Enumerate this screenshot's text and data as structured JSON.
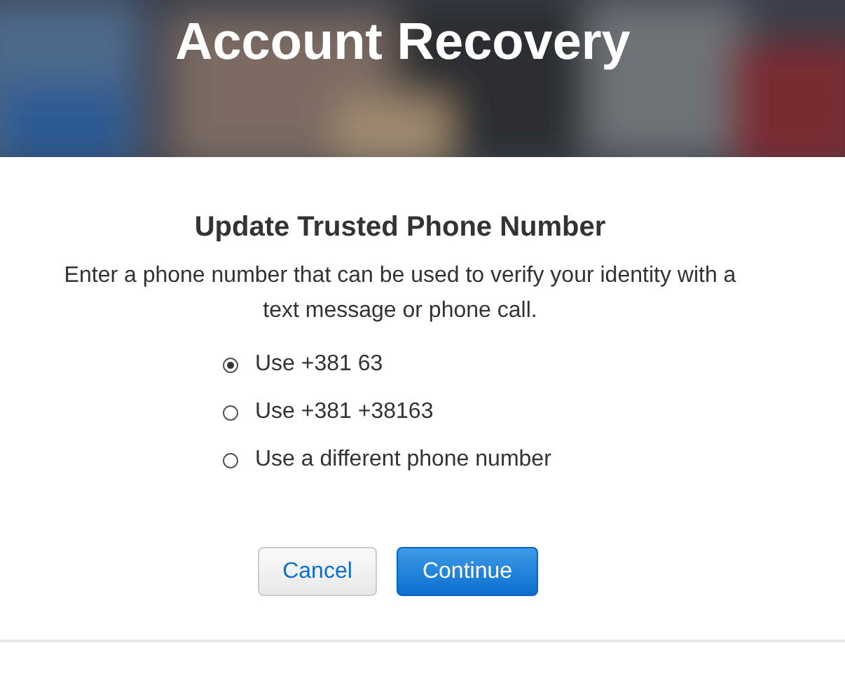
{
  "header": {
    "title": "Account Recovery"
  },
  "heading": "Update Trusted Phone Number",
  "description": "Enter a phone number that can be used to verify your identity with a text message or phone call.",
  "options": [
    {
      "label": "Use +381 63",
      "selected": true
    },
    {
      "label": "Use +381 +38163",
      "selected": false
    },
    {
      "label": "Use a different phone number",
      "selected": false
    }
  ],
  "buttons": [
    {
      "label": "Cancel",
      "kind": "secondary"
    },
    {
      "label": "Continue",
      "kind": "primary"
    }
  ]
}
